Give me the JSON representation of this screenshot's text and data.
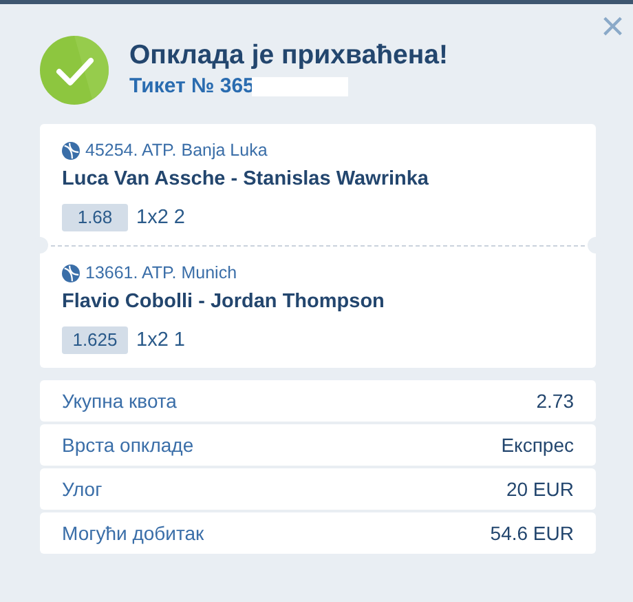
{
  "header": {
    "title": "Опклада је прихваћена!",
    "ticket": "Тикет № 365",
    "close": "×"
  },
  "events": [
    {
      "league": "45254. ATP. Banja Luka",
      "match": "Luca Van Assche - Stanislas Wawrinka",
      "odds": "1.68",
      "pick": "1x2 2"
    },
    {
      "league": "13661. ATP. Munich",
      "match": "Flavio Cobolli - Jordan Thompson",
      "odds": "1.625",
      "pick": "1x2 1"
    }
  ],
  "summary": [
    {
      "label": "Укупна квота",
      "value": "2.73"
    },
    {
      "label": "Врста опкладе",
      "value": "Експрес"
    },
    {
      "label": "Улог",
      "value": "20 EUR"
    },
    {
      "label": "Могући добитак",
      "value": "54.6 EUR"
    }
  ]
}
